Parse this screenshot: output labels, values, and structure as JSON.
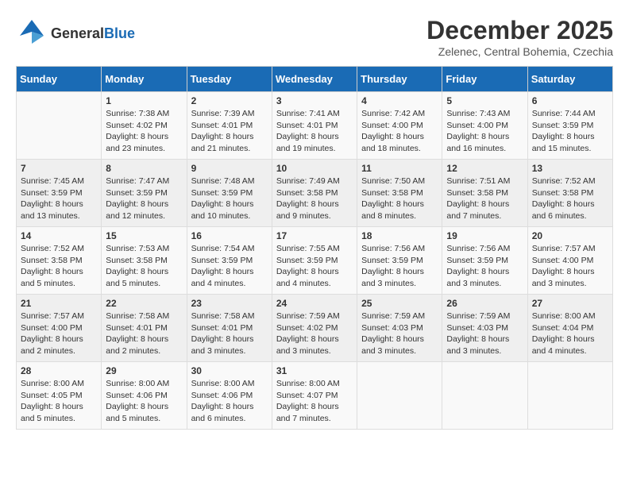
{
  "header": {
    "logo_general": "General",
    "logo_blue": "Blue",
    "month_title": "December 2025",
    "subtitle": "Zelenec, Central Bohemia, Czechia"
  },
  "days_of_week": [
    "Sunday",
    "Monday",
    "Tuesday",
    "Wednesday",
    "Thursday",
    "Friday",
    "Saturday"
  ],
  "weeks": [
    [
      {
        "day": "",
        "content": ""
      },
      {
        "day": "1",
        "content": "Sunrise: 7:38 AM\nSunset: 4:02 PM\nDaylight: 8 hours and 23 minutes."
      },
      {
        "day": "2",
        "content": "Sunrise: 7:39 AM\nSunset: 4:01 PM\nDaylight: 8 hours and 21 minutes."
      },
      {
        "day": "3",
        "content": "Sunrise: 7:41 AM\nSunset: 4:01 PM\nDaylight: 8 hours and 19 minutes."
      },
      {
        "day": "4",
        "content": "Sunrise: 7:42 AM\nSunset: 4:00 PM\nDaylight: 8 hours and 18 minutes."
      },
      {
        "day": "5",
        "content": "Sunrise: 7:43 AM\nSunset: 4:00 PM\nDaylight: 8 hours and 16 minutes."
      },
      {
        "day": "6",
        "content": "Sunrise: 7:44 AM\nSunset: 3:59 PM\nDaylight: 8 hours and 15 minutes."
      }
    ],
    [
      {
        "day": "7",
        "content": "Sunrise: 7:45 AM\nSunset: 3:59 PM\nDaylight: 8 hours and 13 minutes."
      },
      {
        "day": "8",
        "content": "Sunrise: 7:47 AM\nSunset: 3:59 PM\nDaylight: 8 hours and 12 minutes."
      },
      {
        "day": "9",
        "content": "Sunrise: 7:48 AM\nSunset: 3:59 PM\nDaylight: 8 hours and 10 minutes."
      },
      {
        "day": "10",
        "content": "Sunrise: 7:49 AM\nSunset: 3:58 PM\nDaylight: 8 hours and 9 minutes."
      },
      {
        "day": "11",
        "content": "Sunrise: 7:50 AM\nSunset: 3:58 PM\nDaylight: 8 hours and 8 minutes."
      },
      {
        "day": "12",
        "content": "Sunrise: 7:51 AM\nSunset: 3:58 PM\nDaylight: 8 hours and 7 minutes."
      },
      {
        "day": "13",
        "content": "Sunrise: 7:52 AM\nSunset: 3:58 PM\nDaylight: 8 hours and 6 minutes."
      }
    ],
    [
      {
        "day": "14",
        "content": "Sunrise: 7:52 AM\nSunset: 3:58 PM\nDaylight: 8 hours and 5 minutes."
      },
      {
        "day": "15",
        "content": "Sunrise: 7:53 AM\nSunset: 3:58 PM\nDaylight: 8 hours and 5 minutes."
      },
      {
        "day": "16",
        "content": "Sunrise: 7:54 AM\nSunset: 3:59 PM\nDaylight: 8 hours and 4 minutes."
      },
      {
        "day": "17",
        "content": "Sunrise: 7:55 AM\nSunset: 3:59 PM\nDaylight: 8 hours and 4 minutes."
      },
      {
        "day": "18",
        "content": "Sunrise: 7:56 AM\nSunset: 3:59 PM\nDaylight: 8 hours and 3 minutes."
      },
      {
        "day": "19",
        "content": "Sunrise: 7:56 AM\nSunset: 3:59 PM\nDaylight: 8 hours and 3 minutes."
      },
      {
        "day": "20",
        "content": "Sunrise: 7:57 AM\nSunset: 4:00 PM\nDaylight: 8 hours and 3 minutes."
      }
    ],
    [
      {
        "day": "21",
        "content": "Sunrise: 7:57 AM\nSunset: 4:00 PM\nDaylight: 8 hours and 2 minutes."
      },
      {
        "day": "22",
        "content": "Sunrise: 7:58 AM\nSunset: 4:01 PM\nDaylight: 8 hours and 2 minutes."
      },
      {
        "day": "23",
        "content": "Sunrise: 7:58 AM\nSunset: 4:01 PM\nDaylight: 8 hours and 3 minutes."
      },
      {
        "day": "24",
        "content": "Sunrise: 7:59 AM\nSunset: 4:02 PM\nDaylight: 8 hours and 3 minutes."
      },
      {
        "day": "25",
        "content": "Sunrise: 7:59 AM\nSunset: 4:03 PM\nDaylight: 8 hours and 3 minutes."
      },
      {
        "day": "26",
        "content": "Sunrise: 7:59 AM\nSunset: 4:03 PM\nDaylight: 8 hours and 3 minutes."
      },
      {
        "day": "27",
        "content": "Sunrise: 8:00 AM\nSunset: 4:04 PM\nDaylight: 8 hours and 4 minutes."
      }
    ],
    [
      {
        "day": "28",
        "content": "Sunrise: 8:00 AM\nSunset: 4:05 PM\nDaylight: 8 hours and 5 minutes."
      },
      {
        "day": "29",
        "content": "Sunrise: 8:00 AM\nSunset: 4:06 PM\nDaylight: 8 hours and 5 minutes."
      },
      {
        "day": "30",
        "content": "Sunrise: 8:00 AM\nSunset: 4:06 PM\nDaylight: 8 hours and 6 minutes."
      },
      {
        "day": "31",
        "content": "Sunrise: 8:00 AM\nSunset: 4:07 PM\nDaylight: 8 hours and 7 minutes."
      },
      {
        "day": "",
        "content": ""
      },
      {
        "day": "",
        "content": ""
      },
      {
        "day": "",
        "content": ""
      }
    ]
  ]
}
